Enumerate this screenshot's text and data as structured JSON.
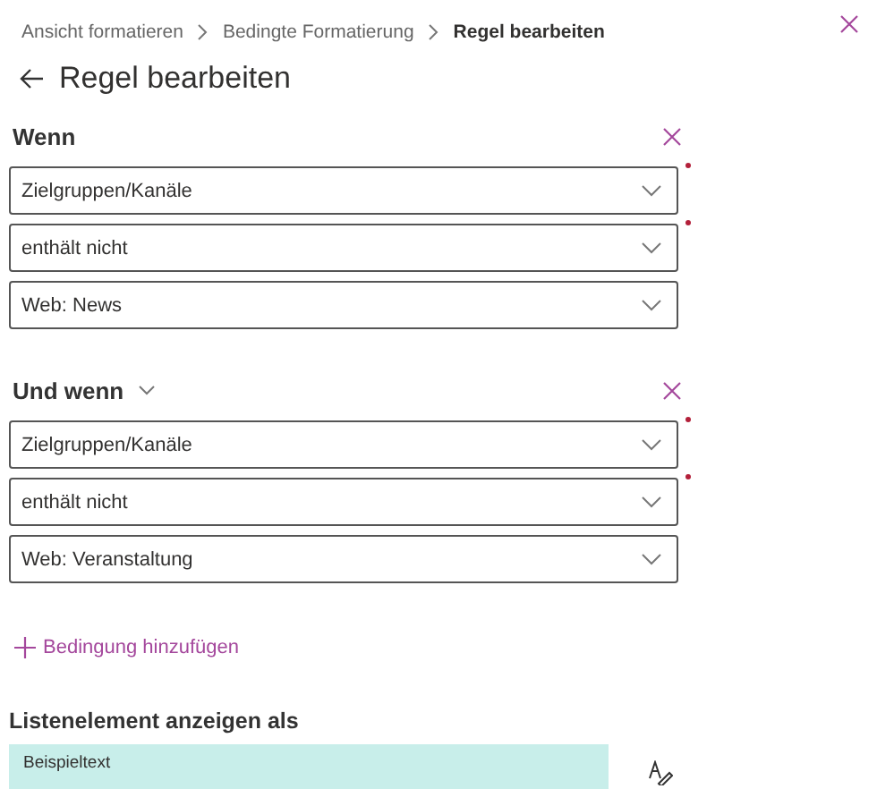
{
  "breadcrumb": [
    {
      "label": "Ansicht formatieren",
      "current": false
    },
    {
      "label": "Bedingte Formatierung",
      "current": false
    },
    {
      "label": "Regel bearbeiten",
      "current": true
    }
  ],
  "title": "Regel bearbeiten",
  "conditions": [
    {
      "label": "Wenn",
      "has_caret": false,
      "fields": [
        {
          "value": "Zielgruppen/Kanäle",
          "required": true
        },
        {
          "value": "enthält nicht",
          "required": true
        },
        {
          "value": "Web: News",
          "required": false
        }
      ]
    },
    {
      "label": "Und wenn",
      "has_caret": true,
      "fields": [
        {
          "value": "Zielgruppen/Kanäle",
          "required": true
        },
        {
          "value": "enthält nicht",
          "required": true
        },
        {
          "value": "Web: Veranstaltung",
          "required": false
        }
      ]
    }
  ],
  "add_condition": "Bedingung hinzufügen",
  "display": {
    "label": "Listenelement anzeigen als",
    "preview": "Beispieltext",
    "color": "#c8eeea"
  }
}
